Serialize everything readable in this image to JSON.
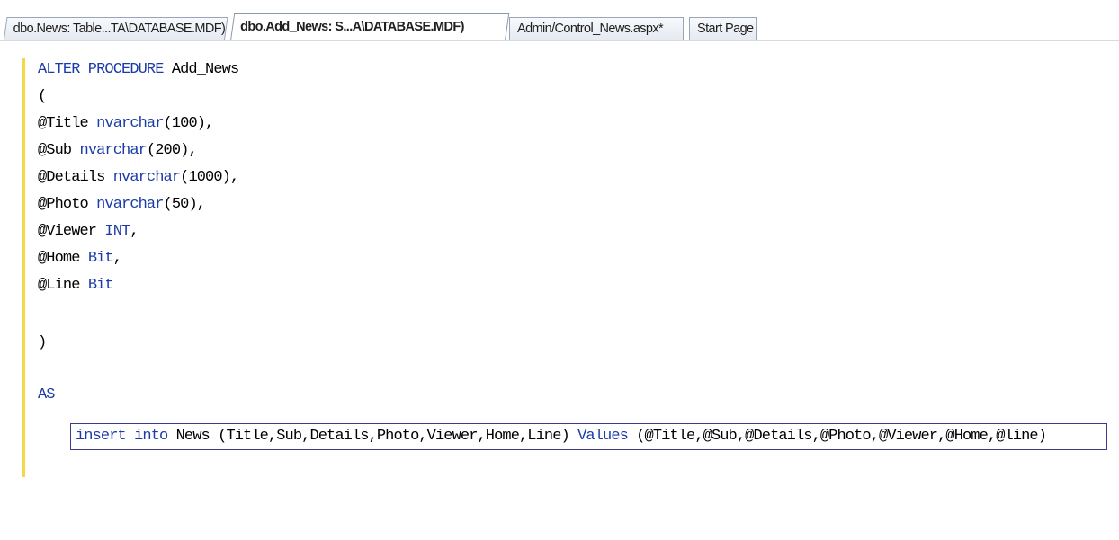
{
  "tabs": [
    {
      "label": "dbo.News: Table...TA\\DATABASE.MDF)",
      "active": false
    },
    {
      "label": "dbo.Add_News: S...A\\DATABASE.MDF)",
      "active": true
    },
    {
      "label": "Admin/Control_News.aspx*",
      "active": false
    },
    {
      "label": "Start Page",
      "active": false
    }
  ],
  "code": {
    "line1": {
      "kw1": "ALTER PROCEDURE",
      "rest": " Add_News"
    },
    "line2": "(",
    "line3": {
      "param": "@Title ",
      "type": "nvarchar",
      "rest": "(100),"
    },
    "line4": {
      "param": "@Sub ",
      "type": "nvarchar",
      "rest": "(200),"
    },
    "line5": {
      "param": "@Details ",
      "type": "nvarchar",
      "rest": "(1000),"
    },
    "line6": {
      "param": "@Photo ",
      "type": "nvarchar",
      "rest": "(50),"
    },
    "line7": {
      "param": "@Viewer ",
      "type": "INT",
      "rest": ","
    },
    "line8": {
      "param": "@Home ",
      "type": "Bit",
      "rest": ","
    },
    "line9": {
      "param": "@Line ",
      "type": "Bit",
      "rest": ""
    },
    "line10": ")",
    "line11": "AS",
    "line12": {
      "kw1": "insert into",
      "mid": " News (Title,Sub,Details,Photo,Viewer,Home,Line) ",
      "kw2": "Values",
      "rest": " (@Title,@Sub,@Details,@Photo,@Viewer,@Home,@line)"
    }
  },
  "colors": {
    "keyword": "#1b3ca8",
    "change_margin": "#f5d84a",
    "current_line_border": "#3b3b8a"
  }
}
